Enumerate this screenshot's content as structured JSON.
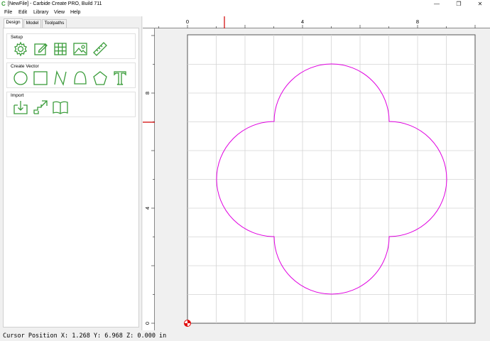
{
  "window": {
    "title": "[NewFile] - Carbide Create PRO, Build 711",
    "app_icon": "carbide-c-icon",
    "controls": [
      "minimize-icon",
      "restore-icon",
      "close-icon"
    ]
  },
  "menu": [
    "File",
    "Edit",
    "Library",
    "View",
    "Help"
  ],
  "tabs": [
    {
      "label": "Design",
      "active": true
    },
    {
      "label": "Model",
      "active": false
    },
    {
      "label": "Toolpaths",
      "active": false
    }
  ],
  "groups": {
    "setup": {
      "title": "Setup",
      "tools": [
        "gear-icon",
        "edit-job-icon",
        "grid-icon",
        "image-icon",
        "ruler-icon"
      ]
    },
    "create_vector": {
      "title": "Create Vector",
      "tools": [
        "circle-icon",
        "rectangle-icon",
        "polyline-icon",
        "curve-icon",
        "polygon-icon",
        "text-icon"
      ]
    },
    "import": {
      "title": "Import",
      "tools": [
        "import-svg-icon",
        "import-dxf-icon",
        "open-book-icon"
      ]
    }
  },
  "rulers": {
    "top_labels": [
      "0",
      "4",
      "8"
    ],
    "left_labels": [
      "8",
      "4",
      "0"
    ],
    "cursor_marker_color": "#d00000"
  },
  "canvas": {
    "grid_color": "#d4d4d4",
    "shape_color": "#e000e0",
    "shape": "quatrefoil"
  },
  "status": {
    "cursor_position": "Cursor Position X: 1.268 Y: 6.968 Z: 0.000 in"
  },
  "colors": {
    "tool_icon": "#3a9c3a",
    "origin_marker": "#e00000"
  }
}
